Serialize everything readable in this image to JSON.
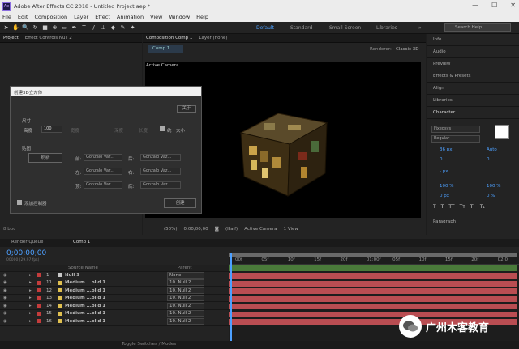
{
  "title_bar": {
    "app_icon_label": "Ae",
    "title": "Adobe After Effects CC 2018 - Untitled Project.aep *",
    "minimize": "—",
    "maximize": "☐",
    "close": "✕"
  },
  "menu": [
    "File",
    "Edit",
    "Composition",
    "Layer",
    "Effect",
    "Animation",
    "View",
    "Window",
    "Help"
  ],
  "workspaces": {
    "default": "Default",
    "standard": "Standard",
    "small_screen": "Small Screen",
    "libraries": "Libraries",
    "overflow": "»"
  },
  "search": {
    "placeholder": "Search Help"
  },
  "left_panel": {
    "tab_project": "Project",
    "tab_effect_controls": "Effect Controls Null 2",
    "bpc": "8 bpc"
  },
  "comp_panel": {
    "tab_comp": "Composition Comp 1",
    "tab_layer": "Layer (none)",
    "subtab": "Comp 1",
    "renderer_label": "Renderer:",
    "renderer_value": "Classic 3D",
    "camera_label": "Active Camera",
    "zoom": "(50%)",
    "time": "0;00;00;00",
    "resolution": "(Half)",
    "view": "Active Camera",
    "views": "1 View"
  },
  "right_panel": {
    "items": [
      "Info",
      "Audio",
      "Preview",
      "Effects & Presets",
      "Align",
      "Libraries",
      "Character"
    ],
    "paragraph": "Paragraph",
    "font": "Fixedsys",
    "style": "Regular",
    "size": "36 px",
    "leading": "Auto",
    "kerning": "0",
    "tracking": "0",
    "stroke": "- px",
    "vscale": "100 %",
    "hscale": "100 %",
    "baseline": "0 px",
    "tsume": "0 %"
  },
  "dialog": {
    "title": "创建3D立方体",
    "about": "关于",
    "size_label": "尺寸",
    "height_label": "高度",
    "height_value": "100",
    "width_label": "宽度",
    "depth_label": "深度",
    "length_label": "长度",
    "unify_label": "统一大小",
    "map_label": "贴图",
    "refresh": "刷新",
    "face_front": "前:",
    "face_back": "后:",
    "face_left": "左:",
    "face_right": "右:",
    "face_top": "顶:",
    "face_bottom": "底:",
    "face_value": "Gonzalo Vaz...",
    "add_controller": "添加控制器",
    "create": "创建"
  },
  "timeline": {
    "tab_render": "Render Queue",
    "tab_comp": "Comp 1",
    "timecode": "0;00;00;00",
    "fps": "00000 (29.97 fps)",
    "header_source": "Source Name",
    "header_parent": "Parent",
    "ruler": [
      "00f",
      "05f",
      "10f",
      "15f",
      "20f",
      "01:00f",
      "05f",
      "10f",
      "15f",
      "20f",
      "02:0"
    ],
    "toggle": "Toggle Switches / Modes"
  },
  "layers": [
    {
      "num": "1",
      "name": "Null 3",
      "parent": "None",
      "color": "#c8c8c8"
    },
    {
      "num": "11",
      "name": "Medium ...olid 1",
      "parent": "10. Null 2",
      "color": "#e0c050"
    },
    {
      "num": "12",
      "name": "Medium ...olid 1",
      "parent": "10. Null 2",
      "color": "#e0c050"
    },
    {
      "num": "13",
      "name": "Medium ...olid 1",
      "parent": "10. Null 2",
      "color": "#e0c050"
    },
    {
      "num": "14",
      "name": "Medium ...olid 1",
      "parent": "10. Null 2",
      "color": "#e0c050"
    },
    {
      "num": "15",
      "name": "Medium ...olid 1",
      "parent": "10. Null 2",
      "color": "#e0c050"
    },
    {
      "num": "16",
      "name": "Medium ...olid 1",
      "parent": "10. Null 2",
      "color": "#e0c050"
    }
  ],
  "watermark": {
    "text": "广州木客教育"
  },
  "colors": {
    "accent": "#4da0ff",
    "track": "#b94d52",
    "layer_label": "#c43c3c"
  }
}
